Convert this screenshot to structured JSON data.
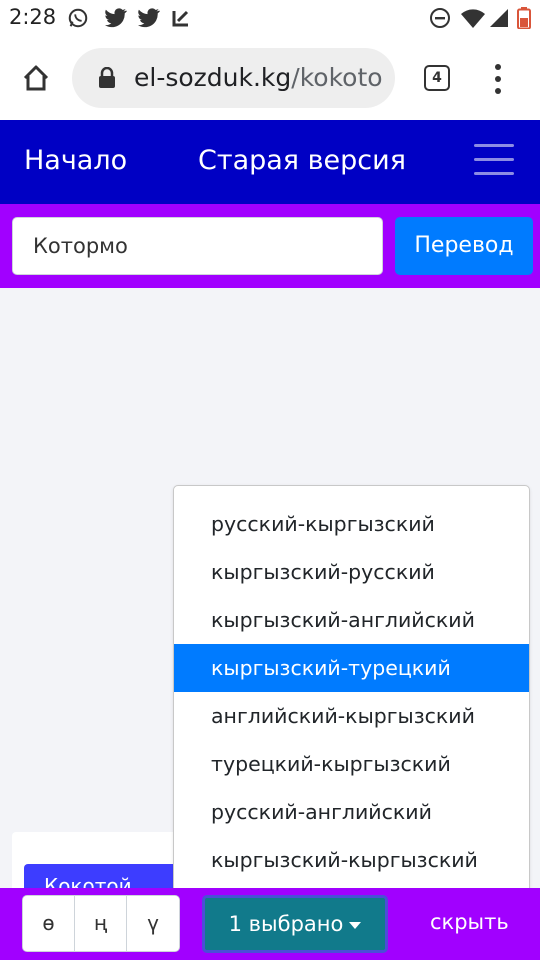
{
  "status_bar": {
    "time": "2:28",
    "left_icons": [
      "whatsapp-icon",
      "twitter-icon",
      "twitter-icon",
      "feedly-icon"
    ],
    "right_icons": [
      "do-not-disturb-icon",
      "wifi-icon",
      "signal-icon",
      "battery-icon"
    ]
  },
  "browser": {
    "url_domain": "el-sozduk.kg",
    "url_path": "/kokoto",
    "tab_count": "4"
  },
  "navbar": {
    "home": "Начало",
    "old_version": "Старая версия"
  },
  "search": {
    "value": "Котормо",
    "button": "Перевод"
  },
  "card": {
    "button_partial": "Кокотой"
  },
  "dropdown": {
    "options": [
      "русский-кыргызский",
      "кыргызский-русский",
      "кыргызский-английский",
      "кыргызский-турецкий",
      "английский-кыргызский",
      "турецкий-кыргызский",
      "русский-английский",
      "кыргызский-кыргызский"
    ],
    "active_index": 3
  },
  "bottom": {
    "letters": [
      "ө",
      "ң",
      "ү"
    ],
    "selected": "1 выбрано",
    "hide": "скрыть"
  },
  "colors": {
    "navbar": "#0000c4",
    "accent_purple": "#a100ff",
    "primary": "#007bff",
    "teal": "#117a8b"
  }
}
